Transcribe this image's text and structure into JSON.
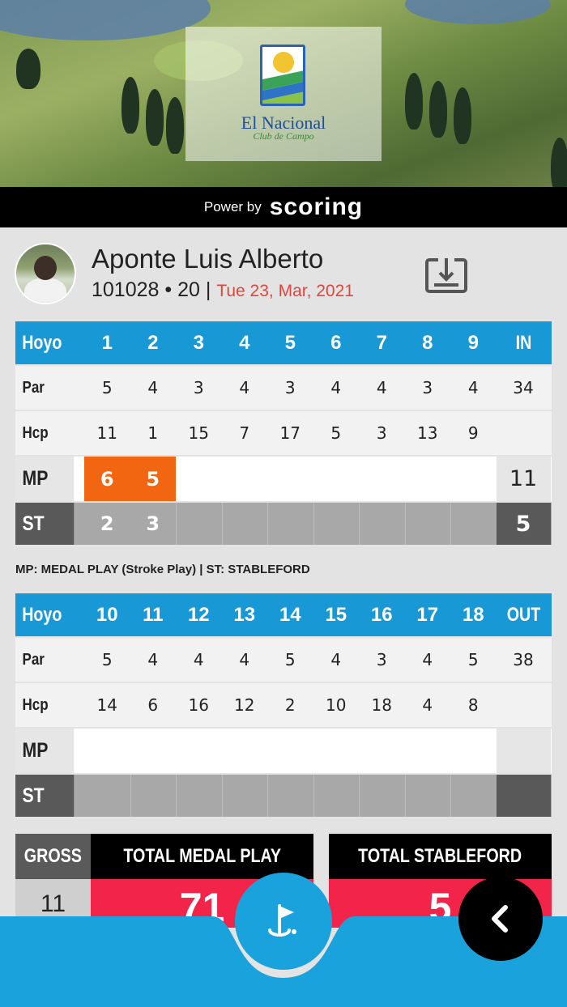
{
  "club": {
    "name": "El Nacional",
    "subtitle": "Club de Campo"
  },
  "power": {
    "label": "Power by",
    "brand": "scoring"
  },
  "player": {
    "name": "Aponte Luis Alberto",
    "id": "101028",
    "handicap": "20",
    "separator": "|",
    "date": "Tue 23, Mar, 2021"
  },
  "front": {
    "header": {
      "label": "Hoyo",
      "holes": [
        "1",
        "2",
        "3",
        "4",
        "5",
        "6",
        "7",
        "8",
        "9"
      ],
      "total": "IN"
    },
    "par": {
      "label": "Par",
      "values": [
        "5",
        "4",
        "3",
        "4",
        "3",
        "4",
        "4",
        "3",
        "4"
      ],
      "total": "34"
    },
    "hcp": {
      "label": "Hcp",
      "values": [
        "11",
        "1",
        "15",
        "7",
        "17",
        "5",
        "3",
        "13",
        "9"
      ],
      "total": ""
    },
    "mp": {
      "label": "MP",
      "values": [
        "6",
        "5",
        "",
        "",
        "",
        "",
        "",
        "",
        ""
      ],
      "total": "11"
    },
    "st": {
      "label": "ST",
      "values": [
        "2",
        "3",
        "",
        "",
        "",
        "",
        "",
        "",
        ""
      ],
      "total": "5"
    }
  },
  "legend": "MP: MEDAL PLAY (Stroke Play) | ST: STABLEFORD",
  "back": {
    "header": {
      "label": "Hoyo",
      "holes": [
        "10",
        "11",
        "12",
        "13",
        "14",
        "15",
        "16",
        "17",
        "18"
      ],
      "total": "OUT"
    },
    "par": {
      "label": "Par",
      "values": [
        "5",
        "4",
        "4",
        "4",
        "5",
        "4",
        "3",
        "4",
        "5"
      ],
      "total": "38"
    },
    "hcp": {
      "label": "Hcp",
      "values": [
        "14",
        "6",
        "16",
        "12",
        "2",
        "10",
        "18",
        "4",
        "8"
      ],
      "total": ""
    },
    "mp": {
      "label": "MP",
      "values": [
        "",
        "",
        "",
        "",
        "",
        "",
        "",
        "",
        ""
      ],
      "total": ""
    },
    "st": {
      "label": "ST",
      "values": [
        "",
        "",
        "",
        "",
        "",
        "",
        "",
        "",
        ""
      ],
      "total": ""
    }
  },
  "totals": {
    "gross_label": "GROSS",
    "gross_value": "11",
    "medal_label": "TOTAL MEDAL PLAY",
    "medal_value": "71",
    "stableford_label": "TOTAL STABLEFORD",
    "stableford_value": "5"
  },
  "icons": {
    "download": "download-icon",
    "golf": "golf-flag-icon",
    "back": "chevron-left-icon"
  },
  "colors": {
    "primary": "#1998d6",
    "score_orange": "#f26511",
    "total_red": "#f2244a",
    "date_red": "#e0463c"
  }
}
